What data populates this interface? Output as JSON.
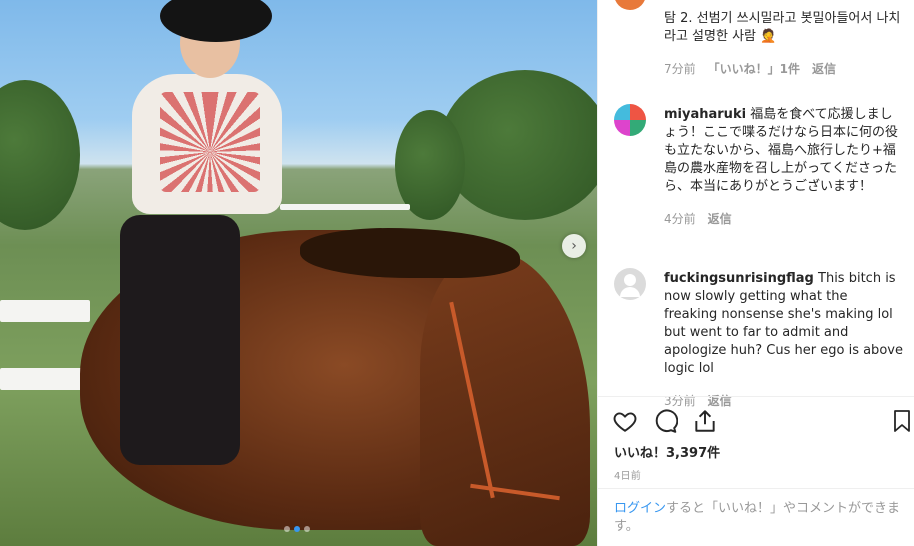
{
  "post": {
    "carousel_next_icon": "chevron-right-icon",
    "slide_count": 3,
    "active_slide": 2
  },
  "comments": [
    {
      "username": "",
      "text": "탐 2. 선범기 쓰시밀라고 봇밀아들어서 나치라고 설명한 사람 🤦",
      "time": "7分前",
      "likes": "「いいね！」1件",
      "reply": "返信"
    },
    {
      "username": "miyaharuki",
      "text": "福島を食べて応援しましょう！ここで喋るだけなら日本に何の役も立たないから、福島へ旅行したり+福島の農水産物を召し上がってくださったら、本当にありがとうございます！",
      "time": "4分前",
      "reply": "返信"
    },
    {
      "username": "fuckingsunrisingflag",
      "text": "This bitch is now slowly getting what the freaking nonsense she's making lol but went to far to admit and apologize huh? Cus her ego is above logic lol",
      "time": "3分前",
      "reply": "返信"
    }
  ],
  "actions": {
    "like_icon": "heart-icon",
    "comment_icon": "comment-icon",
    "share_icon": "share-icon",
    "save_icon": "bookmark-icon"
  },
  "likes_text": "いいね！3,397件",
  "date": "4日前",
  "login": {
    "link": "ログイン",
    "rest": "すると「いいね！」やコメントができます。"
  }
}
